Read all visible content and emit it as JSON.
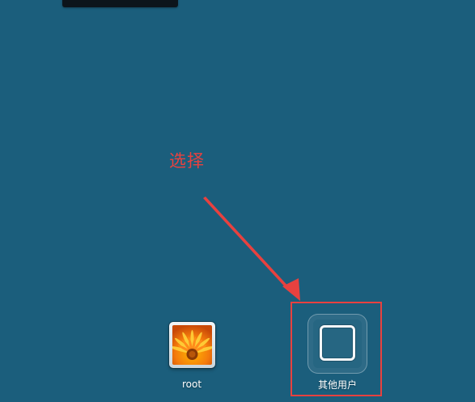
{
  "annotation": {
    "text": "选择",
    "color": "#e8413f"
  },
  "users": [
    {
      "name": "root",
      "avatar": "flower-picture",
      "selected": false
    },
    {
      "name": "其他用户",
      "avatar": "empty-frame",
      "selected": true
    }
  ],
  "colors": {
    "background": "#1b5e7c",
    "label": "#ffffff"
  }
}
